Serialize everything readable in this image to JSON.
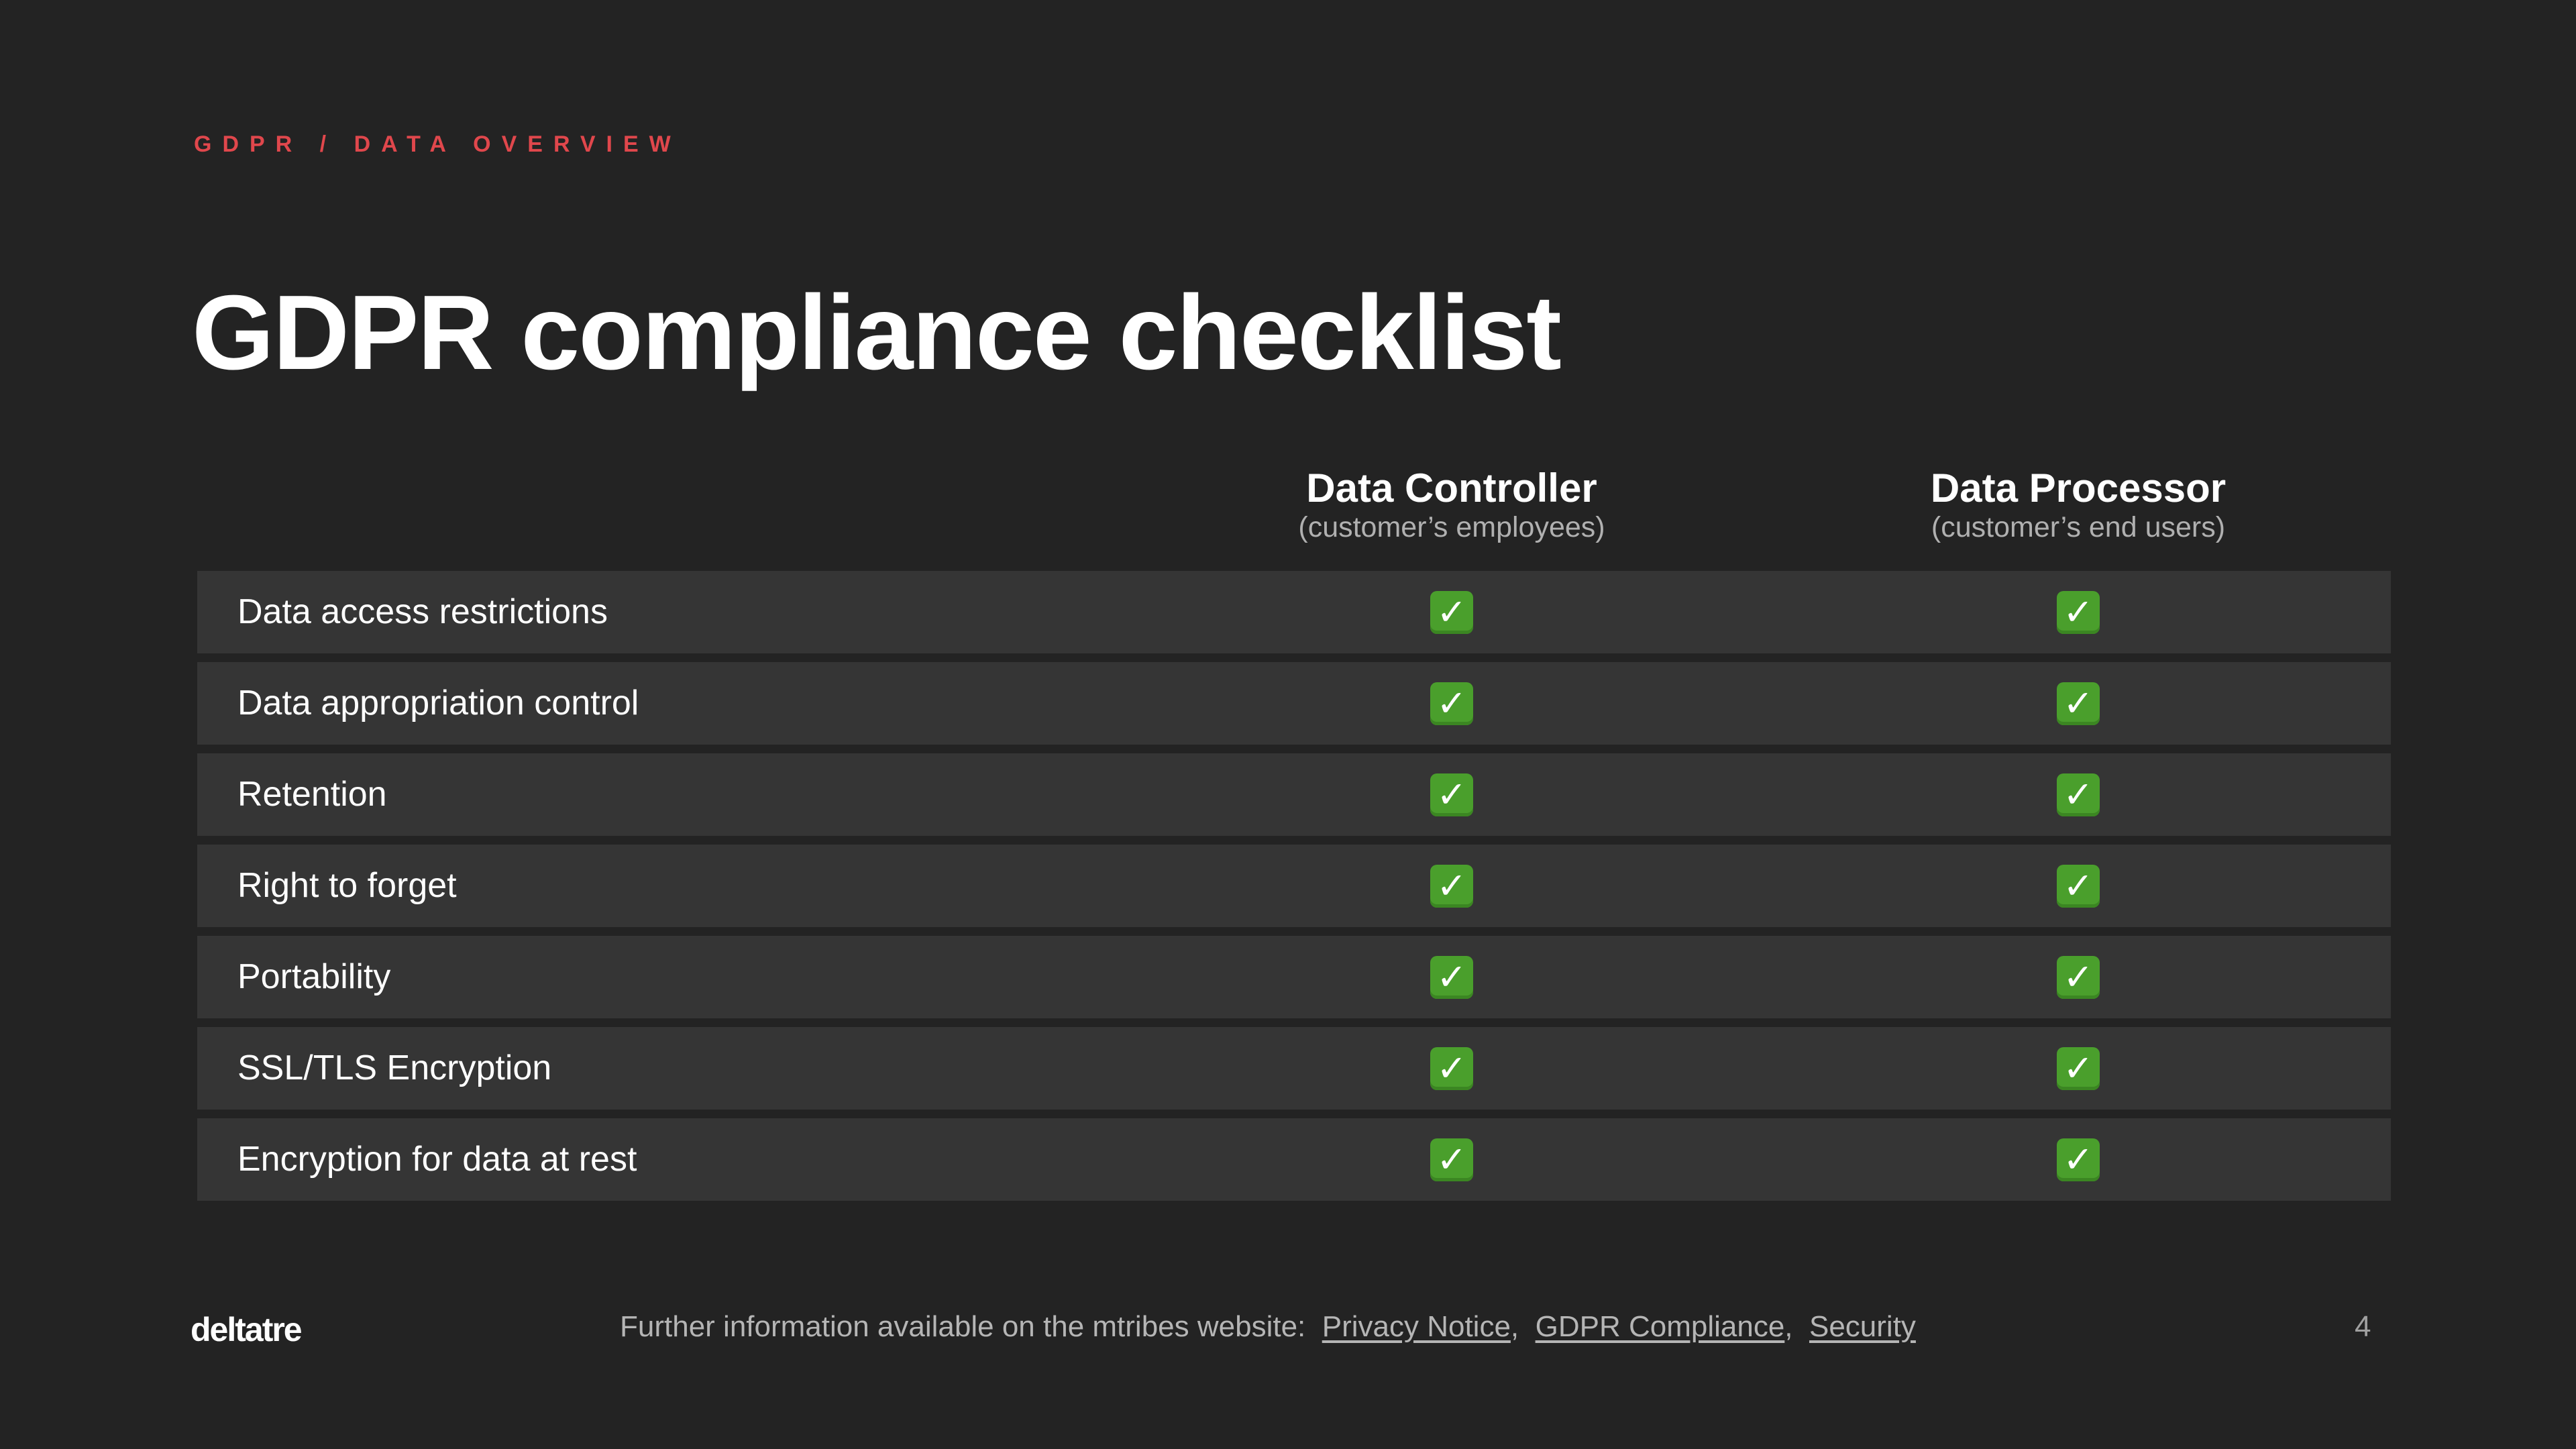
{
  "breadcrumb": "GDPR / DATA OVERVIEW",
  "title": "GDPR compliance checklist",
  "columns": [
    {
      "title": "Data Controller",
      "subtitle": "(customer’s employees)"
    },
    {
      "title": "Data Processor",
      "subtitle": "(customer’s end users)"
    }
  ],
  "rows": [
    {
      "label": "Data access restrictions",
      "controller": true,
      "processor": true
    },
    {
      "label": "Data appropriation control",
      "controller": true,
      "processor": true
    },
    {
      "label": "Retention",
      "controller": true,
      "processor": true
    },
    {
      "label": "Right to forget",
      "controller": true,
      "processor": true
    },
    {
      "label": "Portability",
      "controller": true,
      "processor": true
    },
    {
      "label": "SSL/TLS Encryption",
      "controller": true,
      "processor": true
    },
    {
      "label": "Encryption for data at rest",
      "controller": true,
      "processor": true
    }
  ],
  "check_icon": "check-mark-button-icon",
  "check_symbol": "✓",
  "footer": {
    "logo": "deltatre",
    "text": "Further information available on the mtribes website:",
    "links": [
      "Privacy Notice",
      "GDPR Compliance",
      "Security"
    ],
    "separator": ",",
    "page_number": "4"
  },
  "colors": {
    "background": "#232323",
    "row_background": "#353535",
    "accent": "#e0474c",
    "check": "#4a9f2c"
  }
}
